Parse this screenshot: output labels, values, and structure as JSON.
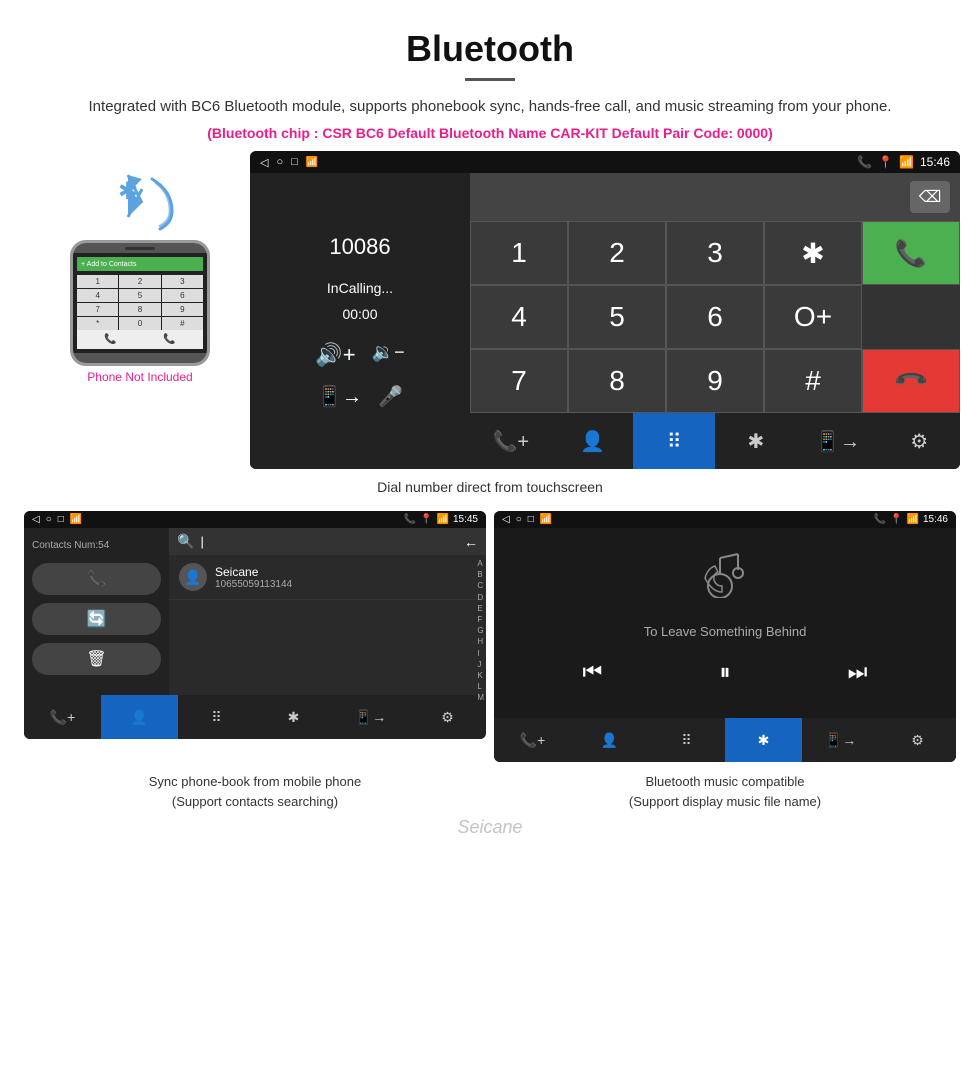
{
  "page": {
    "title": "Bluetooth",
    "divider": "—",
    "description": "Integrated with BC6 Bluetooth module, supports phonebook sync, hands-free call, and music streaming from your phone.",
    "specs": "(Bluetooth chip : CSR BC6    Default Bluetooth Name CAR-KIT    Default Pair Code: 0000)"
  },
  "dial_screen": {
    "status_bar": {
      "left_icons": [
        "◁",
        "○",
        "□",
        "📶"
      ],
      "right_icons": [
        "📞",
        "📍",
        "📶"
      ],
      "time": "15:46"
    },
    "number": "10086",
    "calling_label": "InCalling...",
    "timer": "00:00",
    "vol_up": "🔊+",
    "vol_down": "🔉-",
    "transfer": "📱→",
    "mic": "🎤",
    "keys": [
      "1",
      "2",
      "3",
      "*",
      "4",
      "5",
      "6",
      "O+",
      "7",
      "8",
      "9",
      "#"
    ],
    "call_green_icon": "📞",
    "call_red_icon": "📞",
    "bottom_nav": [
      "📞+",
      "👤",
      "⠿",
      "✱",
      "📱→",
      "⚙"
    ],
    "active_nav": 2,
    "caption": "Dial number direct from touchscreen"
  },
  "phone_mock": {
    "bar_text": "+ Add to Contacts",
    "keys": [
      "1",
      "2",
      "3",
      "4",
      "5",
      "6",
      "7",
      "8",
      "9",
      "*",
      "0",
      "#"
    ],
    "not_included": "Phone Not Included"
  },
  "contacts_screen": {
    "status_bar": {
      "time": "15:45"
    },
    "contacts_num": "Contacts Num:54",
    "contact_name": "Seicane",
    "contact_phone": "10655059113144",
    "alpha_index": [
      "A",
      "B",
      "C",
      "D",
      "E",
      "F",
      "G",
      "H",
      "I",
      "J",
      "K",
      "L",
      "M"
    ],
    "action_btns": [
      "📞",
      "🔄",
      "🗑"
    ],
    "bottom_nav": [
      "📞+",
      "👤",
      "⠿",
      "✱",
      "📱→",
      "⚙"
    ],
    "active_nav": 1,
    "caption_line1": "Sync phone-book from mobile phone",
    "caption_line2": "(Support contacts searching)"
  },
  "music_screen": {
    "status_bar": {
      "time": "15:46"
    },
    "song_title": "To Leave Something Behind",
    "controls": [
      "⏮",
      "⏸",
      "⏭"
    ],
    "bottom_nav": [
      "📞+",
      "👤",
      "⠿",
      "✱",
      "📱→",
      "⚙"
    ],
    "active_nav": 3,
    "caption_line1": "Bluetooth music compatible",
    "caption_line2": "(Support display music file name)"
  },
  "watermark": "Seicane"
}
